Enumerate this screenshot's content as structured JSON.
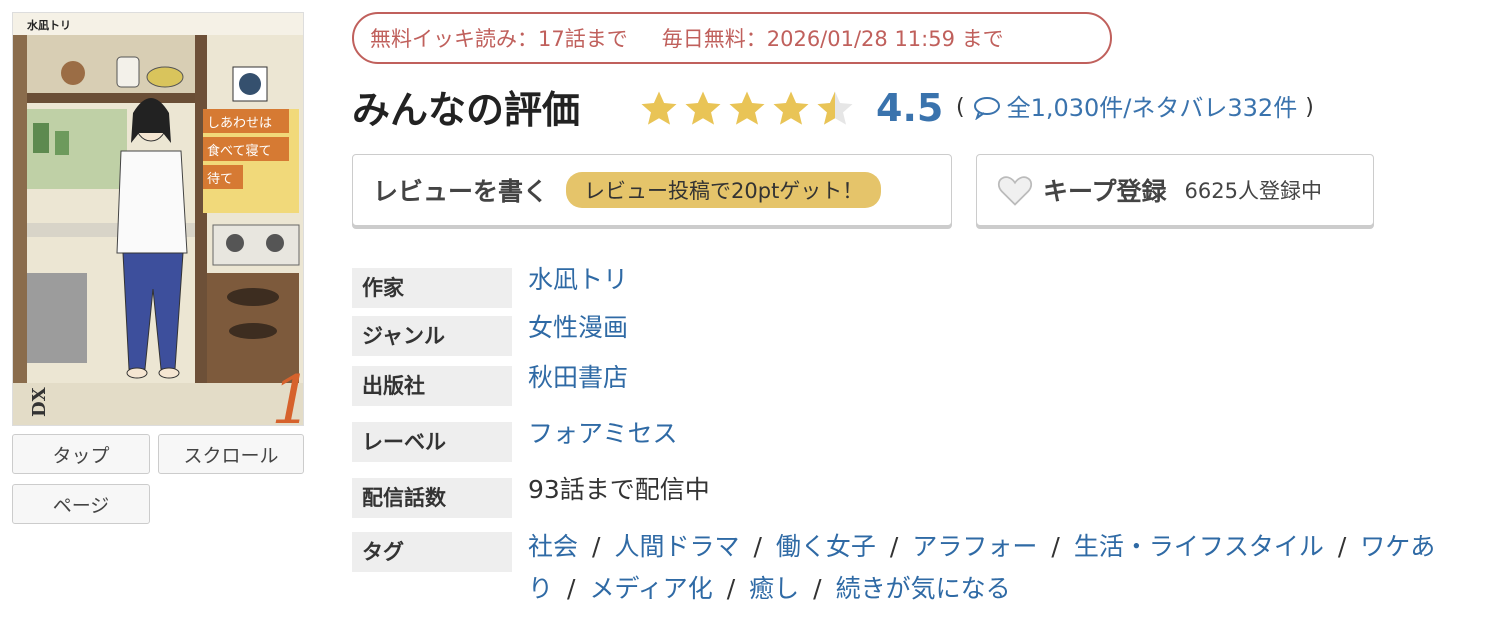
{
  "cover": {
    "author_text": "水凪トリ",
    "title_lines": [
      "しあわせは",
      "食べて寝て",
      "待て"
    ],
    "volume": "1",
    "imprint": "DX"
  },
  "view_modes": {
    "tap": "タップ",
    "scroll": "スクロール",
    "page": "ページ"
  },
  "free_badge": {
    "binge": "無料イッキ読み：17話まで",
    "daily": "毎日無料：2026/01/28 11:59 まで",
    "color": "#c0605c"
  },
  "rating": {
    "title": "みんなの評価",
    "score": "4.5",
    "stars_value": 4.5,
    "stars_max": 5,
    "count_text": "全1,030件/ネタバレ332件",
    "open_paren": "(",
    "close_paren": ")"
  },
  "review_button": {
    "label": "レビューを書く",
    "promo": "レビュー投稿で20ptゲット！"
  },
  "keep_button": {
    "label": "キープ登録",
    "count": "6625人登録中"
  },
  "info": {
    "author": {
      "key": "作家",
      "value": "水凪トリ"
    },
    "genre": {
      "key": "ジャンル",
      "value": "女性漫画"
    },
    "publisher": {
      "key": "出版社",
      "value": "秋田書店"
    },
    "label": {
      "key": "レーベル",
      "value": "フォアミセス"
    },
    "episodes": {
      "key": "配信話数",
      "value": "93話まで配信中"
    },
    "tags": {
      "key": "タグ",
      "separator": "/",
      "items": [
        "社会",
        "人間ドラマ",
        "働く女子",
        "アラフォー",
        "生活・ライフスタイル",
        "ワケあり",
        "メディア化",
        "癒し",
        "続きが気になる"
      ]
    }
  },
  "colors": {
    "link": "#2f6aa5",
    "star": "#e9c456",
    "score": "#3a73ad",
    "promo": "#e5c46a"
  }
}
